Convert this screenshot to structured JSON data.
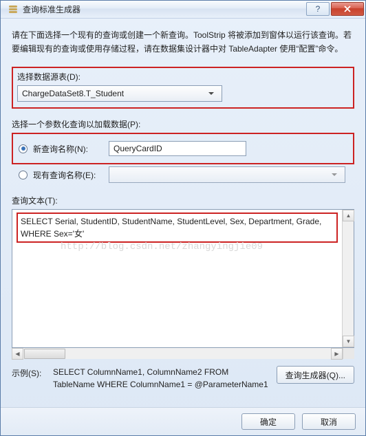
{
  "titlebar": {
    "title": "查询标准生成器",
    "help": "?",
    "close": "X"
  },
  "instructions": "请在下面选择一个现有的查询或创建一个新查询。ToolStrip 将被添加到窗体以运行该查询。若要编辑现有的查询或使用存储过程，请在数据集设计器中对 TableAdapter 使用“配置”命令。",
  "dataSource": {
    "label": "选择数据源表(D):",
    "value": "ChargeDataSet8.T_Student"
  },
  "paramLabel": "选择一个参数化查询以加载数据(P):",
  "radios": {
    "newQuery": {
      "label": "新查询名称(N):",
      "value": "QueryCardID"
    },
    "existingQuery": {
      "label": "现有查询名称(E):",
      "value": ""
    }
  },
  "queryText": {
    "label": "查询文本(T):",
    "value": "SELECT Serial, StudentID, StudentName, StudentLevel, Sex, Department, Grade, WHERE Sex='女'"
  },
  "watermark": "http://blog.csdn.net/zhangyingjie09",
  "example": {
    "label": "示例(S):",
    "text": "SELECT ColumnName1, ColumnName2 FROM TableName WHERE ColumnName1 = @ParameterName1"
  },
  "buttons": {
    "queryBuilder": "查询生成器(Q)...",
    "ok": "确定",
    "cancel": "取消"
  }
}
